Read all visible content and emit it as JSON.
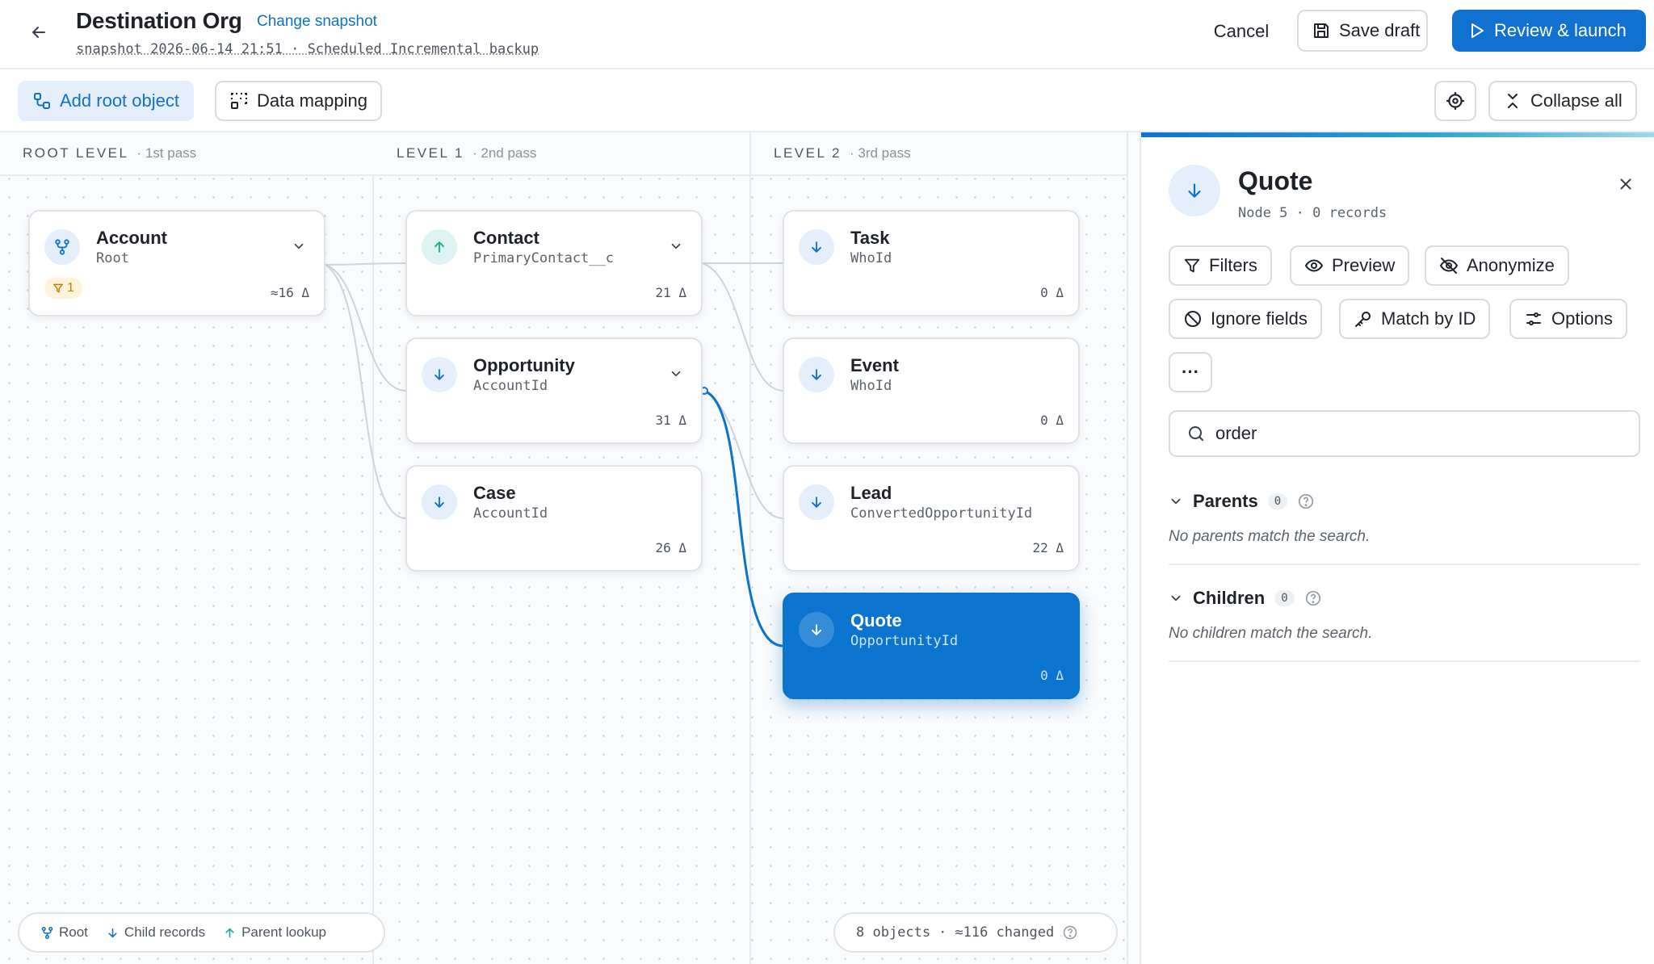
{
  "header": {
    "title": "Destination Org",
    "change_snapshot": "Change snapshot",
    "snapshot_line": "snapshot 2026-06-14 21:51 · Scheduled Incremental backup",
    "cancel": "Cancel",
    "save_draft": "Save draft",
    "review_launch": "Review & launch"
  },
  "toolbar": {
    "add_root": "Add root object",
    "data_mapping": "Data mapping",
    "collapse_all": "Collapse all"
  },
  "columns": [
    {
      "title": "ROOT LEVEL",
      "pass": "· 1st pass"
    },
    {
      "title": "LEVEL 1",
      "pass": "· 2nd pass"
    },
    {
      "title": "LEVEL 2",
      "pass": "· 3rd pass"
    }
  ],
  "nodes": {
    "account": {
      "name": "Account",
      "field": "Root",
      "count": "≈16 Δ",
      "filter_count": "1",
      "icon": "root-icon"
    },
    "contact": {
      "name": "Contact",
      "field": "PrimaryContact__c",
      "count": "21 Δ",
      "icon": "arrow-up-icon"
    },
    "opportunity": {
      "name": "Opportunity",
      "field": "AccountId",
      "count": "31 Δ",
      "icon": "arrow-down-icon"
    },
    "case": {
      "name": "Case",
      "field": "AccountId",
      "count": "26 Δ",
      "icon": "arrow-down-icon"
    },
    "task": {
      "name": "Task",
      "field": "WhoId",
      "count": "0 Δ",
      "icon": "arrow-down-icon"
    },
    "event": {
      "name": "Event",
      "field": "WhoId",
      "count": "0 Δ",
      "icon": "arrow-down-icon"
    },
    "lead": {
      "name": "Lead",
      "field": "ConvertedOpportunityId",
      "count": "22 Δ",
      "icon": "arrow-down-icon"
    },
    "quote": {
      "name": "Quote",
      "field": "OpportunityId",
      "count": "0 Δ",
      "icon": "arrow-down-icon",
      "selected": true
    }
  },
  "legend": {
    "root": "Root",
    "child": "Child records",
    "parent": "Parent lookup"
  },
  "stats": {
    "objects": "8 objects",
    "changed": "≈116 changed"
  },
  "panel": {
    "title": "Quote",
    "subtitle": "Node 5 · 0 records",
    "buttons": {
      "filters": "Filters",
      "preview": "Preview",
      "anonymize": "Anonymize",
      "ignore_fields": "Ignore fields",
      "match_by_id": "Match by ID",
      "options": "Options",
      "more": "···"
    },
    "search": {
      "value": "order",
      "placeholder": "Search"
    },
    "parents": {
      "label": "Parents",
      "count": "0",
      "empty": "No parents match the search."
    },
    "children": {
      "label": "Children",
      "count": "0",
      "empty": "No children match the search."
    }
  },
  "colors": {
    "accent": "#1171d1",
    "selected_node": "#0a74cf",
    "filter_badge": "#c2820a",
    "parent_lookup": "#1aa89a"
  }
}
